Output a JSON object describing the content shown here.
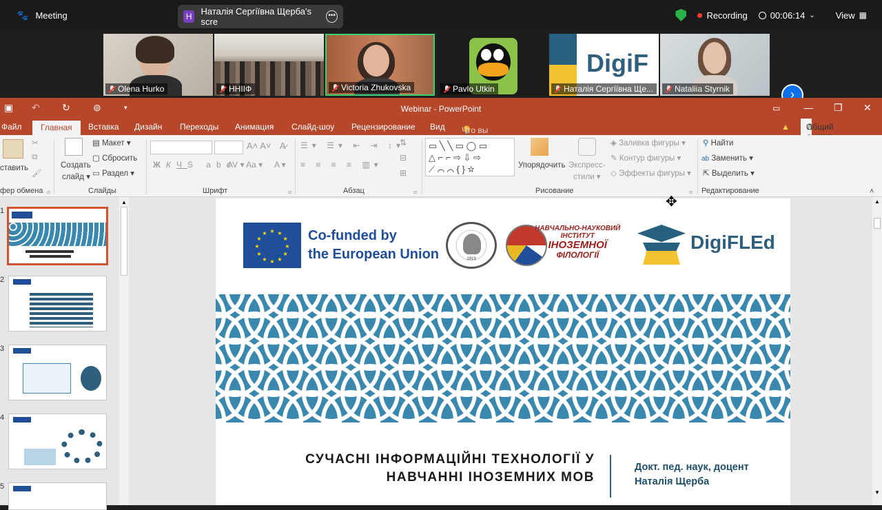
{
  "zoom": {
    "meeting_label": "Meeting",
    "share_initial": "Н",
    "share_label": "Наталія Сергіївна Щерба's scre",
    "recording_label": "Recording",
    "timer": "00:06:14",
    "view_label": "View",
    "participants": [
      "Olena Hurko",
      "ННІІФ",
      "Victoria Zhukovska",
      "Pavlo Utkin",
      "Наталія Сергіївна Ще...",
      "Nataliia Styrnik"
    ],
    "digi_text": "DigiF"
  },
  "ppt": {
    "window_title": "Webinar - PowerPoint",
    "tabs": [
      "Файл",
      "Главная",
      "Вставка",
      "Дизайн",
      "Переходы",
      "Анимация",
      "Слайд-шоу",
      "Рецензирование",
      "Вид"
    ],
    "tell_me": "Что вы хотите сделать?",
    "share": "Общий доступ",
    "ribbon": {
      "paste": "ставить",
      "clipboard_group": "фер обмена",
      "new_slide": "Создать",
      "new_slide2": "слайд",
      "layout": "Макет",
      "reset": "Сбросить",
      "section": "Раздел",
      "slides_group": "Слайды",
      "font_group": "Шрифт",
      "para_group": "Абзац",
      "arrange": "Упорядочить",
      "quick_styles": "Экспресс-",
      "quick_styles2": "стили",
      "fill": "Заливка фигуры",
      "outline": "Контур фигуры",
      "effects": "Эффекты фигуры",
      "drawing_group": "Рисование",
      "find": "Найти",
      "replace": "Заменить",
      "select": "Выделить",
      "editing_group": "Редактирование"
    },
    "slide_numbers": [
      "1",
      "2",
      "3",
      "4",
      "5"
    ],
    "slide": {
      "eu_line1": "Co-funded by",
      "eu_line2": "the European Union",
      "inst_line1": "НАВЧАЛЬНО-НАУКОВИЙ",
      "inst_line2": "ІНСТИТУТ",
      "inst_line3": "ІНОЗЕМНОЇ",
      "inst_line4": "ФІЛОЛОГІЇ",
      "seal_year": "1919",
      "digifled": "DigiFLEd",
      "title_line1": "СУЧАСНІ ІНФОРМАЦІЙНІ ТЕХНОЛОГІЇ У",
      "title_line2": "НАВЧАННІ ІНОЗЕМНИХ МОВ",
      "author_line1": "Докт. пед. наук, доцент",
      "author_line2": "Наталія Щерба"
    },
    "colors": {
      "accent": "#b7472a",
      "pattern": "#3a88ae",
      "eu_blue": "#1f4e9a"
    }
  }
}
